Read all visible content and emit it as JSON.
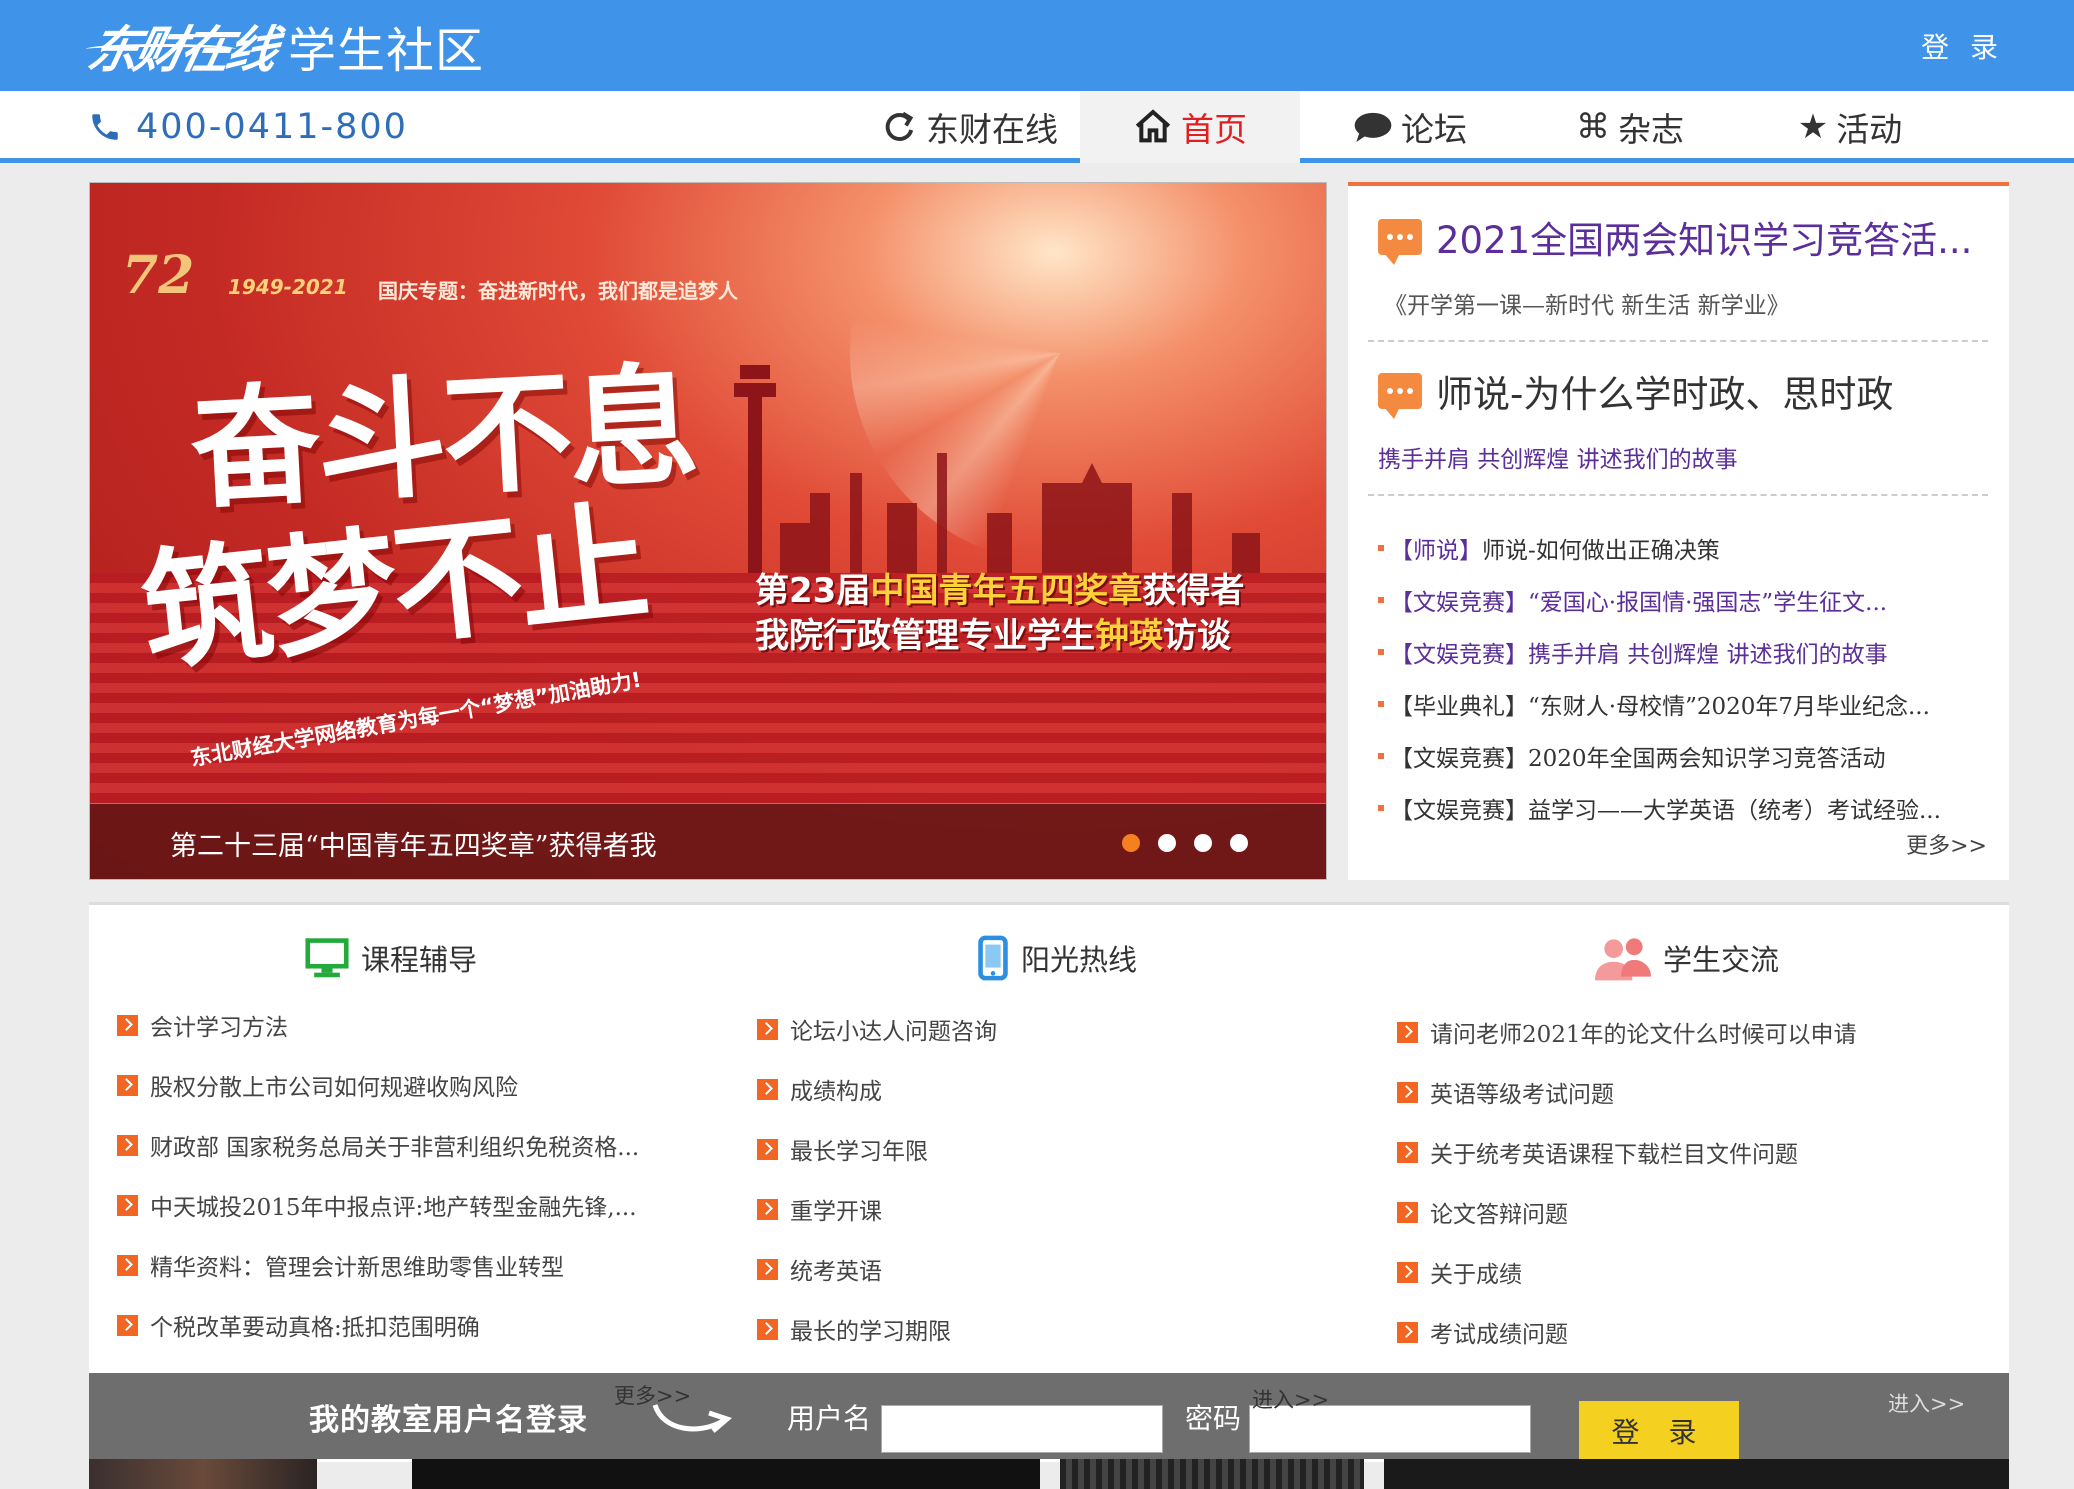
{
  "header": {
    "logo_script": "东财在线",
    "logo_sub": "学生社区",
    "login_label": "登 录"
  },
  "nav": {
    "hotline": "400-0411-800",
    "items": [
      {
        "label": "东财在线",
        "icon": "refresh-arrow-icon"
      },
      {
        "label": "首页",
        "icon": "home-icon",
        "active": true
      },
      {
        "label": "论坛",
        "icon": "speech-bubble-icon"
      },
      {
        "label": "杂志",
        "icon": "command-icon"
      },
      {
        "label": "活动",
        "icon": "star-icon"
      }
    ]
  },
  "banner": {
    "badge_number": "72",
    "badge_years": "1949-2021",
    "badge_topic": "国庆专题：奋进新时代，我们都是追梦人",
    "slogan_line1": "奋斗不息",
    "slogan_line2": "筑梦不止",
    "slogan_sub": "东北财经大学网络教育为每一个“梦想”加油助力!",
    "award_line1_a": "第23届",
    "award_line1_b": "中国青年五四奖章",
    "award_line1_c": "获得者",
    "award_line2_a": "我院行政管理专业学生",
    "award_line2_b": "钟瑛",
    "award_line2_c": "访谈",
    "caption": "第二十三届“中国青年五四奖章”获得者我",
    "slide_count": 4,
    "active_slide": 1
  },
  "news": {
    "headline1": "2021全国两会知识学习竞答活...",
    "headline1_sub": "《开学第一课—新时代 新生活 新学业》",
    "headline2": "师说-为什么学时政、思时政",
    "headline2_sub": "携手并肩 共创辉煌 讲述我们的故事",
    "items": [
      {
        "cat": "【师说】",
        "title": "师说-如何做出正确决策"
      },
      {
        "cat": "【文娱竞赛】",
        "title": "“爱国心·报国情·强国志”学生征文..."
      },
      {
        "cat": "【文娱竞赛】",
        "title": "携手并肩 共创辉煌 讲述我们的故事"
      },
      {
        "cat": "【毕业典礼】",
        "title": "“东财人·母校情”2020年7月毕业纪念..."
      },
      {
        "cat": "【文娱竞赛】",
        "title": "2020年全国两会知识学习竞答活动"
      },
      {
        "cat": "【文娱竞赛】",
        "title": "益学习——大学英语（统考）考试经验..."
      }
    ],
    "more": "更多>>"
  },
  "columns": [
    {
      "title": "课程辅导",
      "icon": "monitor-icon",
      "items": [
        "会计学习方法",
        "股权分散上市公司如何规避收购风险",
        "财政部 国家税务总局关于非营利组织免税资格...",
        "中天城投2015年中报点评:地产转型金融先锋,...",
        "精华资料：管理会计新思维助零售业转型",
        "个税改革要动真格:抵扣范围明确"
      ],
      "more": "更多>>"
    },
    {
      "title": "阳光热线",
      "icon": "phone-device-icon",
      "items": [
        "论坛小达人问题咨询",
        "成绩构成",
        "最长学习年限",
        "重学开课",
        "统考英语",
        "最长的学习期限"
      ],
      "more": "进入>>"
    },
    {
      "title": "学生交流",
      "icon": "users-icon",
      "items": [
        "请问老师2021年的论文什么时候可以申请",
        "英语等级考试问题",
        "关于统考英语课程下载栏目文件问题",
        "论文答辩问题",
        "关于成绩",
        "考试成绩问题"
      ],
      "more": "进入>>"
    }
  ],
  "login_bar": {
    "title": "我的教室用户名登录",
    "username_label": "用户名",
    "password_label": "密码",
    "username_value": "",
    "password_value": "",
    "submit_label": "登 录"
  },
  "colors": {
    "brand_blue": "#3f94ea",
    "accent_orange": "#f26522",
    "news_purple": "#5b2e9a",
    "login_yellow": "#f4d020"
  }
}
